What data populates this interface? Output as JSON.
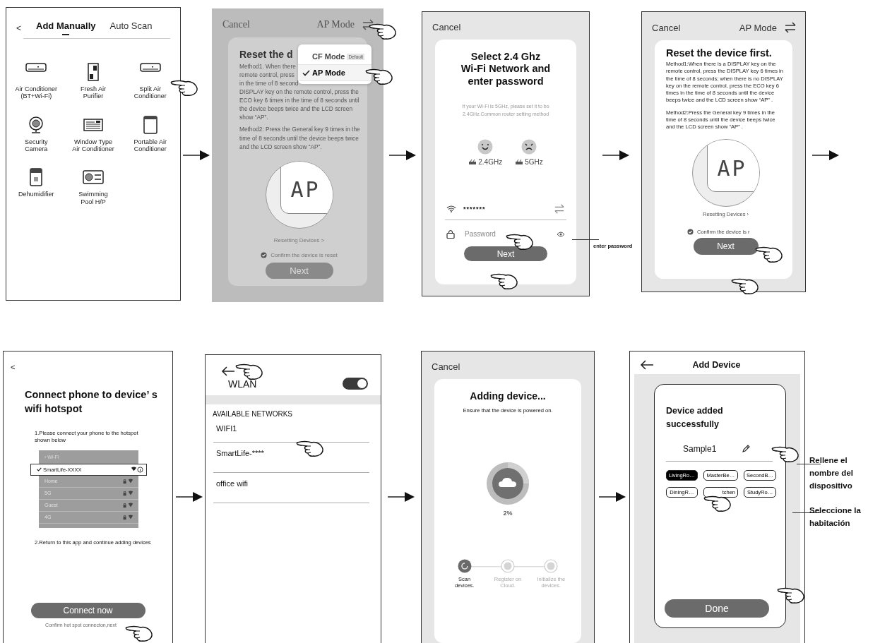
{
  "rows": [
    {
      "screens": [
        {
          "kind": "device_list",
          "back": "<",
          "tabs": [
            {
              "label": "Add Manually",
              "selected": true
            },
            {
              "label": "Auto Scan",
              "selected": false
            }
          ],
          "devices": [
            {
              "kind": "wall_unit",
              "label": "Air Conditioner\n(BT+Wi-Fi)"
            },
            {
              "kind": "purifier",
              "label": "Fresh Air\nPurifier"
            },
            {
              "kind": "wall_unit",
              "label": "Split Air\nConditioner"
            },
            {
              "kind": "camera",
              "label": "Security\nCamera"
            },
            {
              "kind": "window_unit",
              "label": "Window Type\nAir Conditioner"
            },
            {
              "kind": "portable",
              "label": "Portable Air\nConditioner"
            },
            {
              "kind": "dehumidifier",
              "label": "Dehumidifier"
            },
            {
              "kind": "pool_pump",
              "label": "Swimming\nPool H/P"
            }
          ]
        },
        {
          "kind": "reset_photo",
          "cancel": "Cancel",
          "mode": "AP Mode",
          "title": "Reset the d",
          "lines": [
            "Method1. When there",
            "remote control, press",
            "in the time of 8 second",
            "DISPLAY key on the remote control, press the",
            "ECO key 6 times in the time of 8 seconds until",
            "the device beeps twice and the LCD screen",
            "show “AP”."
          ],
          "lines2": [
            "Method2: Press the General key 9 times in the",
            "time of 8 seconds until the device beeps twice",
            "and the LCD screen show “AP”."
          ],
          "display": "AP",
          "link": "Resetting Devices >",
          "confirm": {
            "text": "Confirm the device is reset",
            "checked": true
          },
          "button": "Next",
          "menu": [
            {
              "label": "CF Mode",
              "badge": "Default",
              "selected": false
            },
            {
              "label": "AP Mode",
              "selected": true
            }
          ]
        },
        {
          "kind": "wifi_password",
          "cancel": "Cancel",
          "title": "Select 2.4 Ghz\nWi-Fi Network and\nenter password",
          "hint": "If your Wi-Fi is 5GHz, please set it to bo 2.4GHz.Common router setting method",
          "bands": [
            {
              "kind": "good",
              "label": "2.4GHz"
            },
            {
              "kind": "bad",
              "label": "5GHz"
            }
          ],
          "network": "*******",
          "password_placeholder": "Password",
          "button": "Next",
          "annotation": "enter password"
        },
        {
          "kind": "reset",
          "cancel": "Cancel",
          "mode": "AP Mode",
          "title": "Reset the device first.",
          "paragraphs": [
            "Method1:When there is a DISPLAY key on the remote control, press the DISPLAY key 6 times in the time of 8 seconds; when there is no DISPLAY key on the remote control, press the ECO key 6 times in the time of 8 seconds until the device beeps twice and the LCD screen show “AP” .",
            "Method2:Press the General key 9 times in the time of 8 seconds until the device beeps twice and the LCD screen show “AP” ."
          ],
          "display": "AP",
          "link": "Resetting Devices ›",
          "confirm": {
            "text": "Confirm the device is r",
            "checked": true
          },
          "button": "Next"
        }
      ]
    },
    {
      "screens": [
        {
          "kind": "hotspot",
          "back": "<",
          "title": "Connect phone to device’ s wifi hotspot",
          "step1": "1.Please connect your phone to the hotspot shown below",
          "inset": {
            "back": "‹ Wi-Fi",
            "networks": [
              {
                "name": "SmartLife-XXXX",
                "selected": true
              },
              {
                "name": "Home",
                "selected": false
              },
              {
                "name": "5G",
                "selected": false
              },
              {
                "name": "Guest",
                "selected": false
              },
              {
                "name": "4G",
                "selected": false
              }
            ]
          },
          "step2": "2.Return to this app and continue adding devices",
          "button": "Connect now",
          "note": "Confirm hot spot connecton,next"
        },
        {
          "kind": "wlan",
          "title": "WLAN",
          "on": true,
          "section": "AVAILABLE NETWORKS",
          "networks": [
            "WIFI1",
            "SmartLife-****",
            "office wifi"
          ]
        },
        {
          "kind": "adding",
          "cancel": "Cancel",
          "title": "Adding device...",
          "subtitle": "Ensure that the device is powered on.",
          "percent": "2%",
          "steps": [
            {
              "label": "Scan\ndevices.",
              "active": true
            },
            {
              "label": "Register on\nCloud.",
              "active": false
            },
            {
              "label": "Initialize the\ndevices.",
              "active": false
            }
          ]
        },
        {
          "kind": "added",
          "title": "Add Device",
          "heading": "Device added\nsuccessfully",
          "name": "Sample1",
          "rooms": [
            {
              "label": "LivingRo…",
              "selected": true
            },
            {
              "label": "MasterBe…",
              "selected": false
            },
            {
              "label": "SecondB…",
              "selected": false
            },
            {
              "label": "DiningR…",
              "selected": false
            },
            {
              "label": "tchen",
              "selected": false
            },
            {
              "label": "StudyRo…",
              "selected": false
            }
          ],
          "button": "Done",
          "annotations": [
            "Rellene el nombre del dispositivo",
            "Seleccione la habitación"
          ]
        }
      ]
    }
  ]
}
